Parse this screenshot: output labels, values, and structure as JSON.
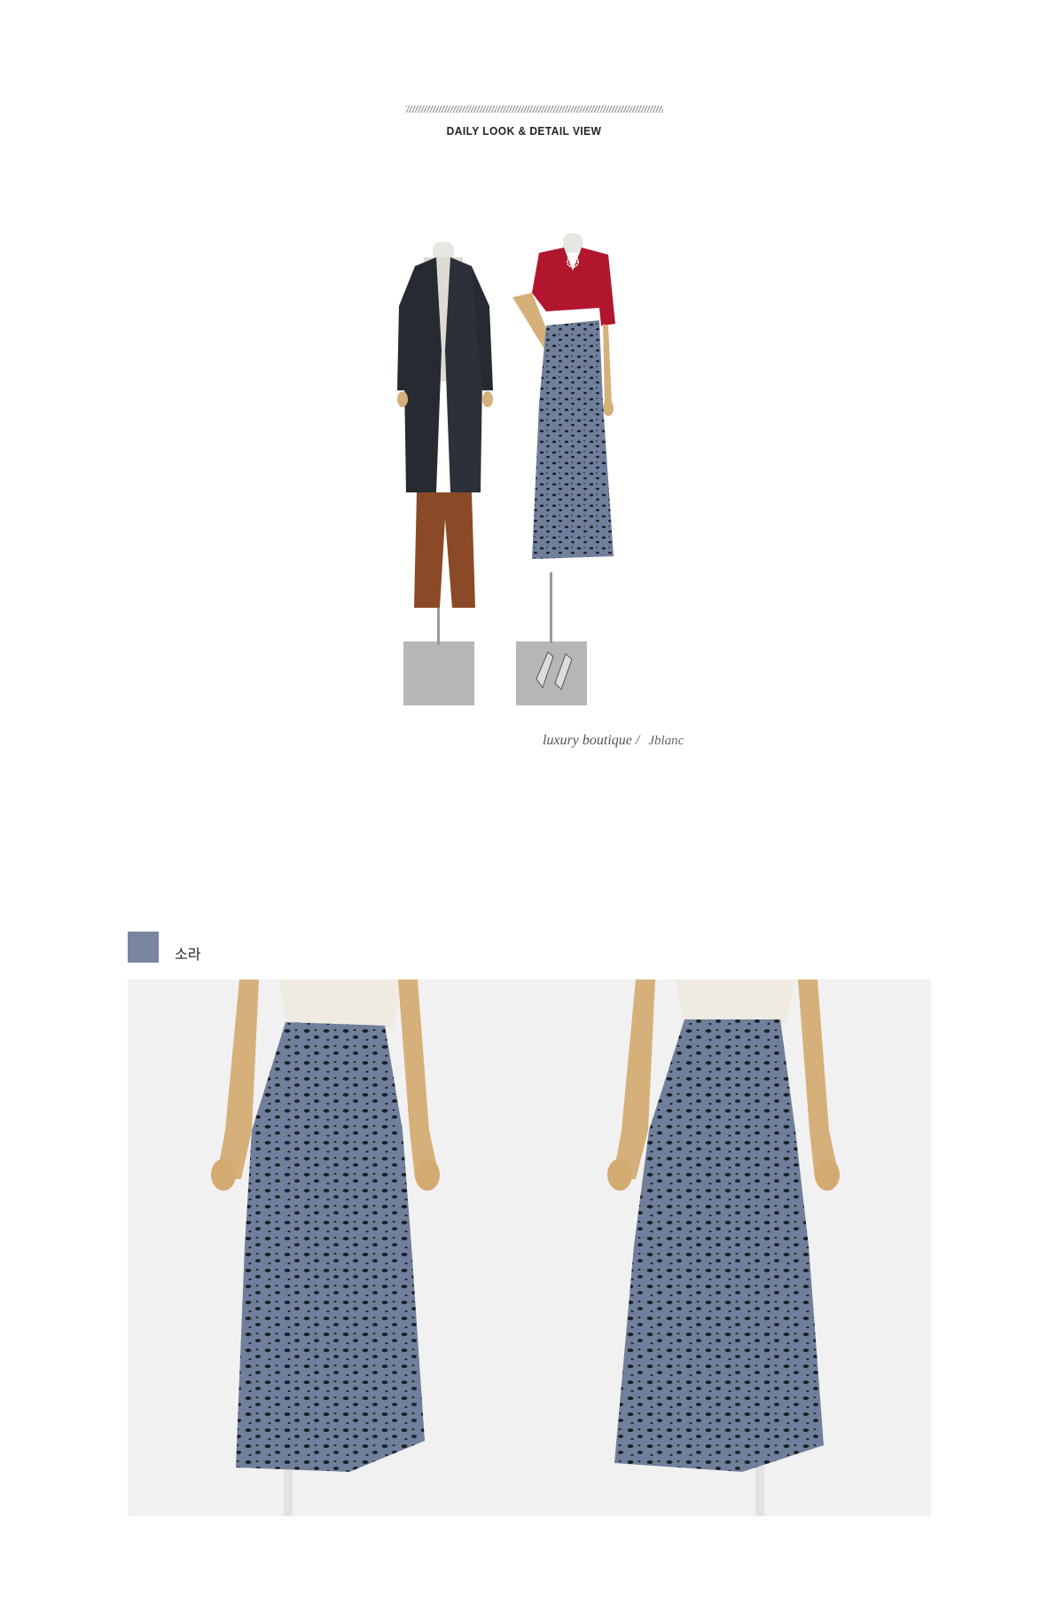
{
  "header": {
    "title": "DAILY LOOK & DETAIL VIEW"
  },
  "caption": {
    "text": "luxury boutique  /",
    "signature": "Jblanc"
  },
  "colors": {
    "swatch": "#7a869f",
    "skirt_base": "#6f7f9c",
    "skirt_spots": "#1d1f24",
    "top_red": "#b1162e",
    "coat": "#262a31",
    "pants": "#8a4a28"
  },
  "color_option": {
    "label": "소라"
  },
  "images": [
    {
      "name": "styled-look-photo",
      "icon": "mannequins-image"
    },
    {
      "name": "skirt-front-photo",
      "icon": "skirt-image"
    },
    {
      "name": "skirt-back-photo",
      "icon": "skirt-image"
    }
  ]
}
